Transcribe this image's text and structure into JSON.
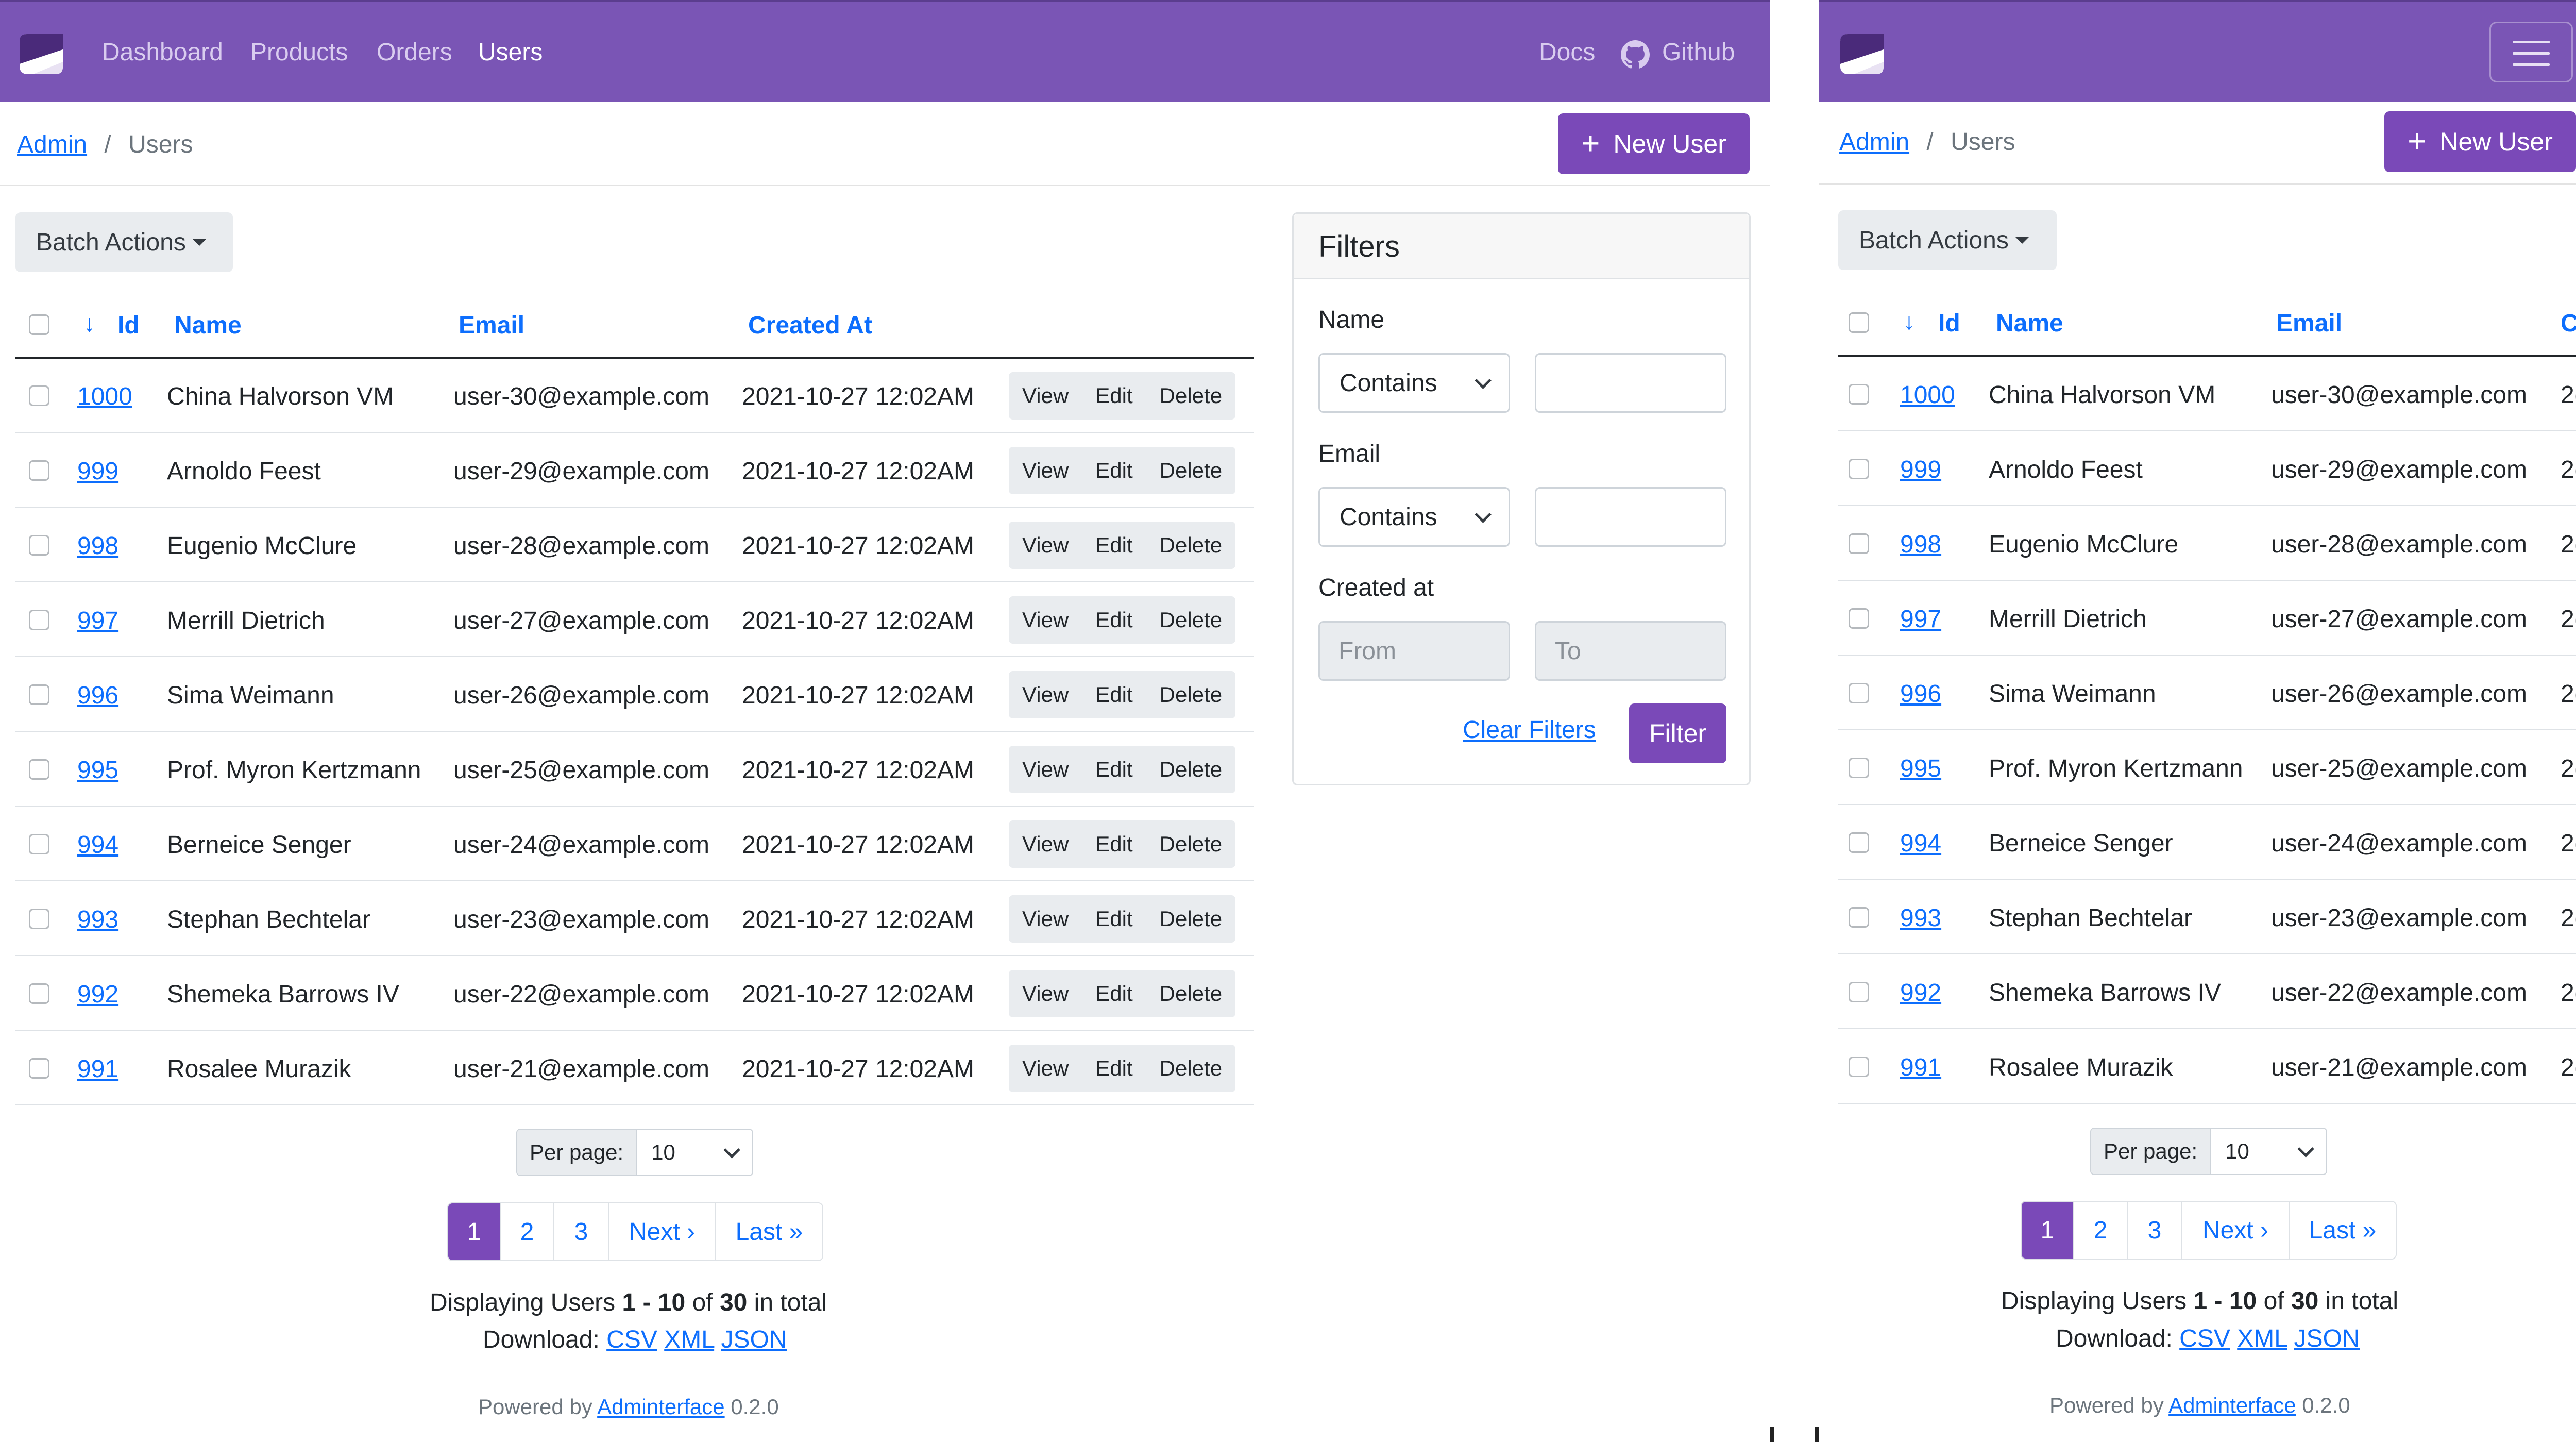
{
  "nav": {
    "items": [
      "Dashboard",
      "Products",
      "Orders",
      "Users"
    ],
    "active": "Users",
    "docs": "Docs",
    "github": "Github"
  },
  "breadcrumb": {
    "root": "Admin",
    "separator": "/",
    "current": "Users"
  },
  "new_user_label": "New User",
  "batch_actions_label": "Batch Actions",
  "table": {
    "columns": [
      "Id",
      "Name",
      "Email",
      "Created At"
    ],
    "actions": [
      "View",
      "Edit",
      "Delete"
    ],
    "rows": [
      {
        "id": "1000",
        "name": "China Halvorson VM",
        "email": "user-30@example.com",
        "created": "2021-10-27 12:02AM"
      },
      {
        "id": "999",
        "name": "Arnoldo Feest",
        "email": "user-29@example.com",
        "created": "2021-10-27 12:02AM"
      },
      {
        "id": "998",
        "name": "Eugenio McClure",
        "email": "user-28@example.com",
        "created": "2021-10-27 12:02AM"
      },
      {
        "id": "997",
        "name": "Merrill Dietrich",
        "email": "user-27@example.com",
        "created": "2021-10-27 12:02AM"
      },
      {
        "id": "996",
        "name": "Sima Weimann",
        "email": "user-26@example.com",
        "created": "2021-10-27 12:02AM"
      },
      {
        "id": "995",
        "name": "Prof. Myron Kertzmann",
        "email": "user-25@example.com",
        "created": "2021-10-27 12:02AM"
      },
      {
        "id": "994",
        "name": "Berneice Senger",
        "email": "user-24@example.com",
        "created": "2021-10-27 12:02AM"
      },
      {
        "id": "993",
        "name": "Stephan Bechtelar",
        "email": "user-23@example.com",
        "created": "2021-10-27 12:02AM"
      },
      {
        "id": "992",
        "name": "Shemeka Barrows IV",
        "email": "user-22@example.com",
        "created": "2021-10-27 12:02AM"
      },
      {
        "id": "991",
        "name": "Rosalee Murazik",
        "email": "user-21@example.com",
        "created": "2021-10-27 12:02AM"
      }
    ],
    "right_truncated_created_header": "C",
    "right_truncated_created_cell": "2("
  },
  "per_page": {
    "label": "Per page:",
    "value": "10"
  },
  "pagination": {
    "pages": [
      "1",
      "2",
      "3"
    ],
    "current": "1",
    "next": "Next ›",
    "last": "Last »"
  },
  "summary": {
    "prefix": "Displaying Users",
    "range": "1 - 10",
    "of": "of",
    "total": "30",
    "suffix": "in total",
    "download_label": "Download:",
    "formats": [
      "CSV",
      "XML",
      "JSON"
    ]
  },
  "powered": {
    "prefix": "Powered by",
    "link": "Adminterface",
    "version": "0.2.0"
  },
  "filters": {
    "title": "Filters",
    "name_label": "Name",
    "name_op": "Contains",
    "email_label": "Email",
    "email_op": "Contains",
    "created_label": "Created at",
    "from_placeholder": "From",
    "to_placeholder": "To",
    "clear": "Clear Filters",
    "submit": "Filter"
  },
  "colors": {
    "navbar": "#7a55b5",
    "primary_button": "#7a49b8",
    "link": "#0d6efd"
  },
  "icons": [
    "logo-icon",
    "github-icon",
    "sort-down-icon",
    "plus-icon",
    "caret-down-icon",
    "chevron-down-icon",
    "hamburger-icon"
  ]
}
